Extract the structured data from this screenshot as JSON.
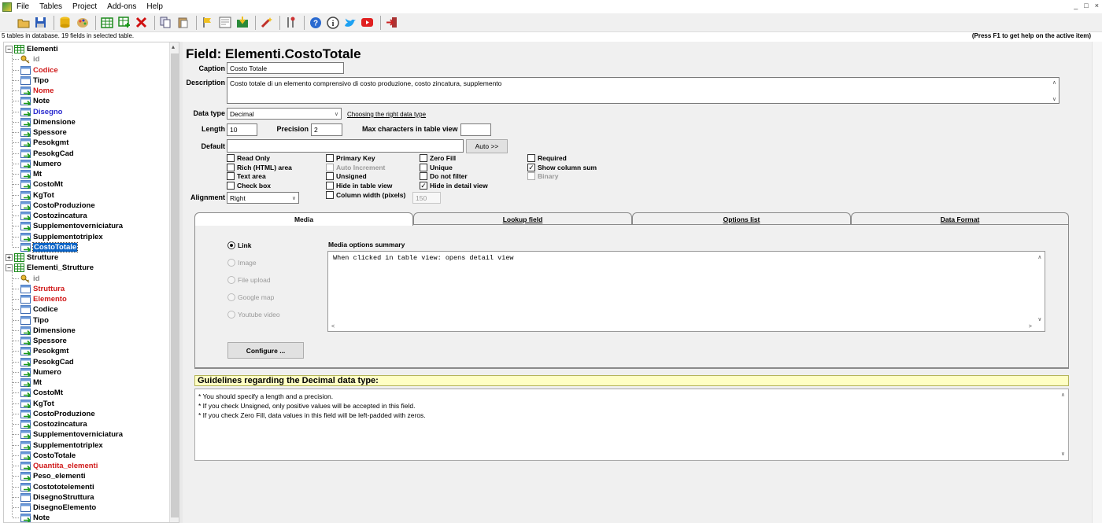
{
  "menu": {
    "items": [
      "File",
      "Tables",
      "Project",
      "Add-ons",
      "Help"
    ]
  },
  "window_controls": {
    "minimize": "_",
    "restore": "□",
    "close": "×"
  },
  "toolbar": {
    "icons": [
      "open-folder-icon",
      "save-icon",
      "database-icon",
      "palette-icon",
      "table-grid-icon",
      "add-table-icon",
      "delete-icon",
      "copy-icon",
      "paste-icon",
      "flag-icon",
      "form-icon",
      "export-icon",
      "magic-wand-icon",
      "tools-icon",
      "help-icon",
      "info-icon",
      "twitter-icon",
      "youtube-icon",
      "exit-icon"
    ]
  },
  "status": {
    "left": "5 tables in database. 19 fields in selected table.",
    "right": "(Press F1 to get help on the active item)"
  },
  "tree": {
    "tables": [
      {
        "label": "Elementi",
        "expanded": true,
        "fields": [
          {
            "label": "id",
            "color": "gray",
            "icon": "key"
          },
          {
            "label": "Codice",
            "color": "red",
            "icon": "field-plain"
          },
          {
            "label": "Tipo",
            "color": "black",
            "icon": "field-plain"
          },
          {
            "label": "Nome",
            "color": "red",
            "icon": "field-green"
          },
          {
            "label": "Note",
            "color": "black",
            "icon": "field-green"
          },
          {
            "label": "Disegno",
            "color": "blue",
            "icon": "field-green"
          },
          {
            "label": "Dimensione",
            "color": "black",
            "icon": "field-green"
          },
          {
            "label": "Spessore",
            "color": "black",
            "icon": "field-green"
          },
          {
            "label": "Pesokgmt",
            "color": "black",
            "icon": "field-green"
          },
          {
            "label": "PesokgCad",
            "color": "black",
            "icon": "field-green"
          },
          {
            "label": "Numero",
            "color": "black",
            "icon": "field-green"
          },
          {
            "label": "Mt",
            "color": "black",
            "icon": "field-green"
          },
          {
            "label": "CostoMt",
            "color": "black",
            "icon": "field-green"
          },
          {
            "label": "KgTot",
            "color": "black",
            "icon": "field-green"
          },
          {
            "label": "CostoProduzione",
            "color": "black",
            "icon": "field-green"
          },
          {
            "label": "Costozincatura",
            "color": "black",
            "icon": "field-green"
          },
          {
            "label": "Supplementoverniciatura",
            "color": "black",
            "icon": "field-green"
          },
          {
            "label": "Supplementotriplex",
            "color": "black",
            "icon": "field-green"
          },
          {
            "label": "CostoTotale",
            "color": "black",
            "icon": "field-green",
            "selected": true
          }
        ]
      },
      {
        "label": "Strutture",
        "expanded": false,
        "fields": []
      },
      {
        "label": "Elementi_Strutture",
        "expanded": true,
        "fields": [
          {
            "label": "id",
            "color": "gray",
            "icon": "key"
          },
          {
            "label": "Struttura",
            "color": "red",
            "icon": "field-plain"
          },
          {
            "label": "Elemento",
            "color": "red",
            "icon": "field-plain"
          },
          {
            "label": "Codice",
            "color": "black",
            "icon": "field-plain"
          },
          {
            "label": "Tipo",
            "color": "black",
            "icon": "field-plain"
          },
          {
            "label": "Dimensione",
            "color": "black",
            "icon": "field-green"
          },
          {
            "label": "Spessore",
            "color": "black",
            "icon": "field-green"
          },
          {
            "label": "Pesokgmt",
            "color": "black",
            "icon": "field-green"
          },
          {
            "label": "PesokgCad",
            "color": "black",
            "icon": "field-green"
          },
          {
            "label": "Numero",
            "color": "black",
            "icon": "field-green"
          },
          {
            "label": "Mt",
            "color": "black",
            "icon": "field-green"
          },
          {
            "label": "CostoMt",
            "color": "black",
            "icon": "field-green"
          },
          {
            "label": "KgTot",
            "color": "black",
            "icon": "field-green"
          },
          {
            "label": "CostoProduzione",
            "color": "black",
            "icon": "field-green"
          },
          {
            "label": "Costozincatura",
            "color": "black",
            "icon": "field-green"
          },
          {
            "label": "Supplementoverniciatura",
            "color": "black",
            "icon": "field-green"
          },
          {
            "label": "Supplementotriplex",
            "color": "black",
            "icon": "field-green"
          },
          {
            "label": "CostoTotale",
            "color": "black",
            "icon": "field-green"
          },
          {
            "label": "Quantita_elementi",
            "color": "red",
            "icon": "field-green"
          },
          {
            "label": "Peso_elementi",
            "color": "black",
            "icon": "field-green"
          },
          {
            "label": "Costototelementi",
            "color": "black",
            "icon": "field-green"
          },
          {
            "label": "DisegnoStruttura",
            "color": "black",
            "icon": "field-plain"
          },
          {
            "label": "DisegnoElemento",
            "color": "black",
            "icon": "field-plain"
          },
          {
            "label": "Note",
            "color": "black",
            "icon": "field-green"
          }
        ]
      }
    ]
  },
  "field": {
    "title": "Field: Elementi.CostoTotale",
    "caption_label": "Caption",
    "caption_value": "Costo Totale",
    "description_label": "Description",
    "description_value": "Costo totale di un elemento comprensivo di costo produzione, costo zincatura, supplemento",
    "datatype_label": "Data type",
    "datatype_value": "Decimal",
    "datatype_link": "Choosing the right data type",
    "length_label": "Length",
    "length_value": "10",
    "precision_label": "Precision",
    "precision_value": "2",
    "maxchars_label": "Max characters in table view",
    "maxchars_value": "",
    "default_label": "Default",
    "default_value": "",
    "auto_button": "Auto >>",
    "alignment_label": "Alignment",
    "alignment_value": "Right",
    "column_width_value": "150"
  },
  "options": {
    "col1": [
      {
        "label": "Read Only",
        "checked": false
      },
      {
        "label": "Rich (HTML) area",
        "checked": false
      },
      {
        "label": "Text area",
        "checked": false
      },
      {
        "label": "Check box",
        "checked": false
      }
    ],
    "col2": [
      {
        "label": "Primary Key",
        "checked": false
      },
      {
        "label": "Auto Increment",
        "checked": false,
        "disabled": true
      },
      {
        "label": "Unsigned",
        "checked": false
      },
      {
        "label": "Hide in table view",
        "checked": false
      },
      {
        "label": "Column width (pixels)",
        "checked": false
      }
    ],
    "col3": [
      {
        "label": "Zero Fill",
        "checked": false
      },
      {
        "label": "Unique",
        "checked": false
      },
      {
        "label": "Do not filter",
        "checked": false
      },
      {
        "label": "Hide in detail view",
        "checked": true
      }
    ],
    "col4": [
      {
        "label": "Required",
        "checked": false
      },
      {
        "label": "Show column sum",
        "checked": true
      },
      {
        "label": "Binary",
        "checked": false,
        "disabled": true
      }
    ]
  },
  "tabs": [
    {
      "label": "Media",
      "active": true
    },
    {
      "label": "Lookup field",
      "active": false
    },
    {
      "label": "Options list",
      "active": false
    },
    {
      "label": "Data Format",
      "active": false
    }
  ],
  "media": {
    "radios": [
      {
        "label": "Link",
        "selected": true,
        "disabled": false
      },
      {
        "label": "Image",
        "selected": false,
        "disabled": true
      },
      {
        "label": "File upload",
        "selected": false,
        "disabled": true
      },
      {
        "label": "Google map",
        "selected": false,
        "disabled": true
      },
      {
        "label": "Youtube video",
        "selected": false,
        "disabled": true
      }
    ],
    "summary_label": "Media options summary",
    "summary_text": "When clicked in table view: opens detail view",
    "configure_button": "Configure ..."
  },
  "guidelines": {
    "title": "Guidelines regarding the Decimal data type:",
    "lines": [
      "* You should specify a length and a precision.",
      "* If you check Unsigned, only positive values will be accepted in this field.",
      "* If you check Zero Fill, data values in this field will be left-padded with zeros."
    ]
  }
}
